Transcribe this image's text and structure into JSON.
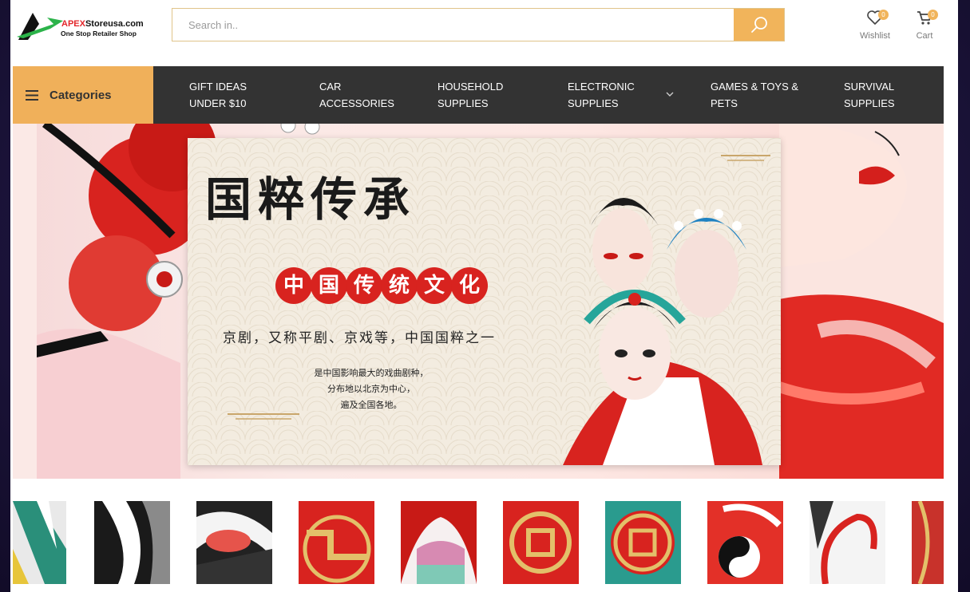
{
  "brand": {
    "name_accent": "APEX",
    "name_rest": "Storeusa.com",
    "tagline": "One Stop Retailer Shop",
    "accent_color": "#f1b45b",
    "nav_bg": "#333333"
  },
  "search": {
    "placeholder": "Search in..",
    "button_icon": "search-icon"
  },
  "header_icons": {
    "wishlist": {
      "label": "Wishlist",
      "count": "0",
      "icon": "heart-icon"
    },
    "cart": {
      "label": "Cart",
      "count": "0",
      "icon": "cart-icon"
    }
  },
  "categories": {
    "label": "Categories",
    "icon": "hamburger-icon"
  },
  "nav": [
    {
      "line1": "GIFT IDEAS",
      "line2": "UNDER $10"
    },
    {
      "line1": "CAR",
      "line2": "ACCESSORIES"
    },
    {
      "line1": "HOUSEHOLD",
      "line2": "SUPPLIES"
    },
    {
      "line1": "ELECTRONIC",
      "line2": "SUPPLIES",
      "has_dropdown": true
    },
    {
      "line1": "GAMES & TOYS &",
      "line2": "PETS"
    },
    {
      "line1": "SURVIVAL",
      "line2": "SUPPLIES"
    }
  ],
  "banner": {
    "title": "国粹传承",
    "subtitle": [
      "中",
      "国",
      "传",
      "统",
      "文",
      "化"
    ],
    "line1": "京剧，又称平剧、京戏等，中国国粹之一",
    "paragraph": [
      "是中国影响最大的戏曲剧种，",
      "分布地以北京为中心，",
      "遍及全国各地。"
    ]
  },
  "thumbnails": {
    "count": 10
  }
}
